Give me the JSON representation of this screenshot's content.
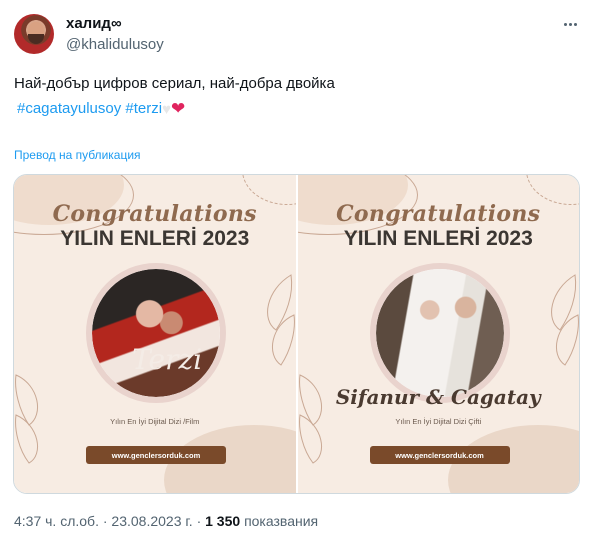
{
  "tweet": {
    "display_name": "халид∞",
    "handle": "@khalidulusoy",
    "text_line1": "Най-добър цифров сериал, най-добра двойка",
    "hashtag1": "#cagatayulusoy",
    "hashtag2": "#terzi",
    "emoji_white_heart": "♥",
    "emoji_red_heart": "❤",
    "translate_label": "Превод на публикация",
    "time": "4:37 ч. сл.об.",
    "separator": "·",
    "date": "23.08.2023 г.",
    "views_count": "1 350",
    "views_label": "показвания"
  },
  "images": [
    {
      "congrats": "Congratulations",
      "title": "YILIN ENLERİ 2023",
      "photo_caption": "Terzi",
      "category": "Yılın En İyi Dijital Dizi /Film",
      "site": "www.genclersorduk.com"
    },
    {
      "congrats": "Congratulations",
      "title": "YILIN ENLERİ 2023",
      "couple": "Sifanur & Cagatay",
      "category": "Yılın En İyi Dijital Dizi Çifti",
      "site": "www.genclersorduk.com"
    }
  ],
  "colors": {
    "accent": "#1d9bf0",
    "text": "#0f1419",
    "secondary": "#536471",
    "card_bg": "#f7ece3",
    "button_brown": "#7a4a2a"
  },
  "icons": [
    "more-icon",
    "white-heart-emoji",
    "red-heart-emoji"
  ]
}
